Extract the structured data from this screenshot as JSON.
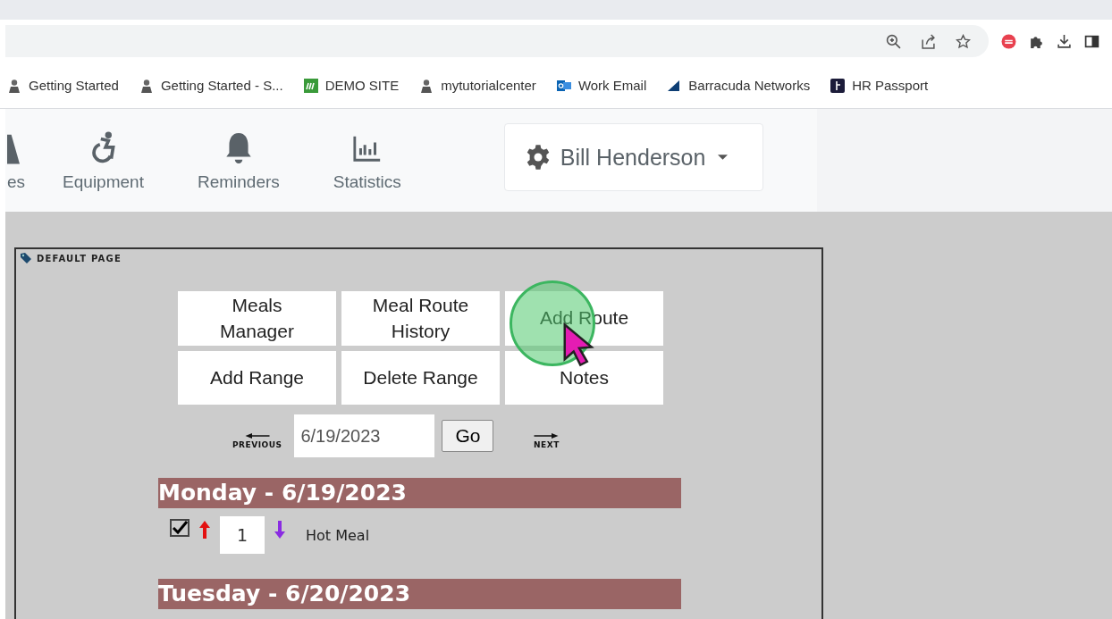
{
  "bookmarks": [
    {
      "label": "Getting Started",
      "kind": "person"
    },
    {
      "label": "Getting Started - S...",
      "kind": "person"
    },
    {
      "label": "DEMO SITE",
      "kind": "letter"
    },
    {
      "label": "mytutorialcenter",
      "kind": "person"
    },
    {
      "label": "Work Email",
      "kind": "mail"
    },
    {
      "label": "Barracuda Networks",
      "kind": "fin"
    },
    {
      "label": "HR Passport",
      "kind": "badge"
    }
  ],
  "nav": [
    {
      "label": "es",
      "kind": "partial"
    },
    {
      "label": "Equipment",
      "kind": "wheelchair"
    },
    {
      "label": "Reminders",
      "kind": "bell"
    },
    {
      "label": "Statistics",
      "kind": "chart"
    }
  ],
  "user_menu": {
    "name": "Bill Henderson"
  },
  "page": {
    "title": "DEFAULT PAGE",
    "buttons": [
      "Meals Manager",
      "Meal Route History",
      "Add Route",
      "Add Range",
      "Delete Range",
      "Notes"
    ],
    "date_nav": {
      "previous": "PREVIOUS",
      "date": "6/19/2023",
      "go": "Go",
      "next": "NEXT"
    },
    "days": [
      {
        "heading": "Monday - 6/19/2023",
        "items": [
          {
            "checked": true,
            "quantity": "1",
            "name": "Hot Meal"
          }
        ]
      },
      {
        "heading": "Tuesday - 6/20/2023"
      }
    ]
  }
}
